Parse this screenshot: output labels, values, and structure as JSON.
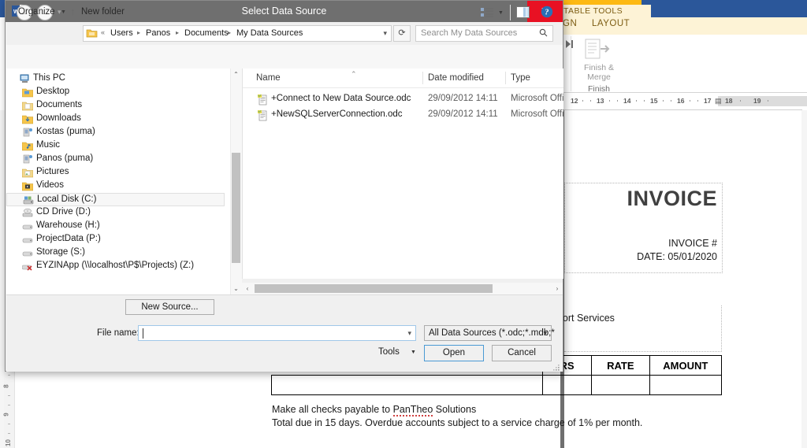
{
  "word": {
    "table_tools_banner": "TABLE TOOLS",
    "tabs": [
      {
        "label": "GN"
      },
      {
        "label": "LAYOUT"
      }
    ],
    "ribbon": {
      "last_record_icon": "last-record-icon",
      "finish_merge_label_line1": "Finish &",
      "finish_merge_label_line2": "Merge",
      "finish_group_label": "Finish"
    },
    "h_ruler": {
      "ticks": [
        "12",
        "13",
        "14",
        "15",
        "16",
        "17",
        "18",
        "19"
      ]
    },
    "v_ruler": {
      "ticks": [
        "8",
        "9",
        "10"
      ]
    },
    "document": {
      "invoice_title": "INVOICE",
      "invoice_number_label": "INVOICE #",
      "invoice_date_label": "DATE: 05/01/2020",
      "support_services": "pport Services",
      "table_headers": [
        "RS",
        "RATE",
        "AMOUNT"
      ],
      "footer_line1_prefix": "Make all checks payable to ",
      "footer_line1_company": "PanTheo",
      "footer_line1_suffix": " Solutions",
      "footer_line2": "Total due in 15 days. Overdue accounts subject to a service charge of 1% per month."
    }
  },
  "dialog": {
    "title": "Select Data Source",
    "app_icon": "word-icon",
    "close_label": "✕",
    "nav": {
      "back_icon": "←",
      "forward_icon": "→",
      "recent_icon": "▾",
      "up_icon": "↑"
    },
    "address": {
      "folder_icon": "folder-icon",
      "overflow": "«",
      "crumbs": [
        "Users",
        "Panos",
        "Documents",
        "My Data Sources"
      ],
      "separator": "▸",
      "dropdown_icon": "▾"
    },
    "refresh_icon": "⟳",
    "search": {
      "placeholder": "Search My Data Sources",
      "icon": "search-icon"
    },
    "toolbar": {
      "organize_label": "Organize",
      "organize_arrow": "▼",
      "new_folder_label": "New folder",
      "view_icon": "view-options-icon",
      "view_arrow": "▼",
      "preview_pane_icon": "preview-pane-icon",
      "help_icon": "help-icon"
    },
    "tree": {
      "items": [
        {
          "label": "This PC",
          "icon": "this-pc-icon",
          "level": 0,
          "selected": false
        },
        {
          "label": "Desktop",
          "icon": "desktop-folder-icon",
          "level": 1,
          "selected": false
        },
        {
          "label": "Documents",
          "icon": "documents-folder-icon",
          "level": 1,
          "selected": false
        },
        {
          "label": "Downloads",
          "icon": "downloads-folder-icon",
          "level": 1,
          "selected": false
        },
        {
          "label": "Kostas (puma)",
          "icon": "network-user-icon",
          "level": 1,
          "selected": false
        },
        {
          "label": "Music",
          "icon": "music-folder-icon",
          "level": 1,
          "selected": false
        },
        {
          "label": "Panos (puma)",
          "icon": "network-user-icon",
          "level": 1,
          "selected": false
        },
        {
          "label": "Pictures",
          "icon": "pictures-folder-icon",
          "level": 1,
          "selected": false
        },
        {
          "label": "Videos",
          "icon": "videos-folder-icon",
          "level": 1,
          "selected": false
        },
        {
          "label": "Local Disk (C:)",
          "icon": "hard-drive-icon",
          "level": 1,
          "selected": true
        },
        {
          "label": "CD Drive (D:)",
          "icon": "cd-drive-icon",
          "level": 1,
          "selected": false
        },
        {
          "label": "Warehouse (H:)",
          "icon": "network-drive-icon",
          "level": 1,
          "selected": false
        },
        {
          "label": "ProjectData (P:)",
          "icon": "network-drive-icon",
          "level": 1,
          "selected": false
        },
        {
          "label": "Storage (S:)",
          "icon": "network-drive-icon",
          "level": 1,
          "selected": false
        },
        {
          "label": "EYZINApp (\\\\localhost\\P$\\Projects) (Z:)",
          "icon": "disconnected-network-drive-icon",
          "level": 1,
          "selected": false
        }
      ],
      "scroll_up_icon": "⌃",
      "scroll_down_icon": "⌄"
    },
    "file_list": {
      "columns": [
        "Name",
        "Date modified",
        "Type"
      ],
      "sort_indicator": "⌃",
      "rows": [
        {
          "icon": "odc-file-icon",
          "name": "+Connect to New Data Source.odc",
          "date_modified": "29/09/2012 14:11",
          "type": "Microsoft Offi"
        },
        {
          "icon": "odc-file-icon",
          "name": "+NewSQLServerConnection.odc",
          "date_modified": "29/09/2012 14:11",
          "type": "Microsoft Offi"
        }
      ],
      "hscroll_left_icon": "‹",
      "hscroll_right_icon": "›"
    },
    "footer": {
      "new_source_label": "New Source...",
      "file_name_label": "File name:",
      "file_name_value": "",
      "file_name_dropdown_icon": "▾",
      "file_type_value": "All Data Sources (*.odc;*.mdb;*",
      "file_type_dropdown_icon": "▾",
      "tools_label": "Tools",
      "tools_arrow": "▼",
      "open_label": "Open",
      "cancel_label": "Cancel"
    }
  },
  "colors": {
    "titlebar": "#6f6f6f",
    "close_red": "#e81123",
    "word_blue": "#2b579a",
    "table_tools_yellow": "#fdb913",
    "accent_open_border": "#4a9ad4"
  }
}
